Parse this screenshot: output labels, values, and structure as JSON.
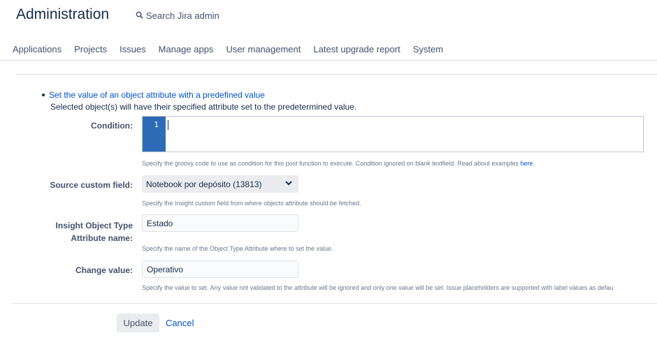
{
  "header": {
    "title": "Administration",
    "search_label": "Search Jira admin"
  },
  "nav": {
    "tabs": [
      {
        "label": "Applications"
      },
      {
        "label": "Projects"
      },
      {
        "label": "Issues"
      },
      {
        "label": "Manage apps"
      },
      {
        "label": "User management"
      },
      {
        "label": "Latest upgrade report"
      },
      {
        "label": "System"
      }
    ]
  },
  "form": {
    "function_title": "Set the value of an object attribute with a predefined value",
    "function_description": "Selected object(s) will have their specified attribute set to the predetermined value.",
    "condition": {
      "label": "Condition:",
      "line_number": "1",
      "help": "Specify the groovy code to use as condition for this post function to execute. Condition ignored on blank textfield. Read about examples",
      "help_link": "here"
    },
    "source_custom_field": {
      "label": "Source custom field:",
      "value": "Notebook por depósito (13813)",
      "help": "Specify the Insight custom field from where objects attribute should be fetched."
    },
    "attribute_name": {
      "label_line1": "Insight Object Type",
      "label_line2": "Attribute name:",
      "value": "Estado",
      "help": "Specify the name of the Object Type Attribute where to set the value."
    },
    "change_value": {
      "label": "Change value:",
      "value": "Operativo",
      "help": "Specify the value to set. Any value not validated to the attribute will be ignored and only one value will be set. Issue placeholders are supported with label values as defau"
    }
  },
  "actions": {
    "update_label": "Update",
    "cancel_label": "Cancel"
  }
}
